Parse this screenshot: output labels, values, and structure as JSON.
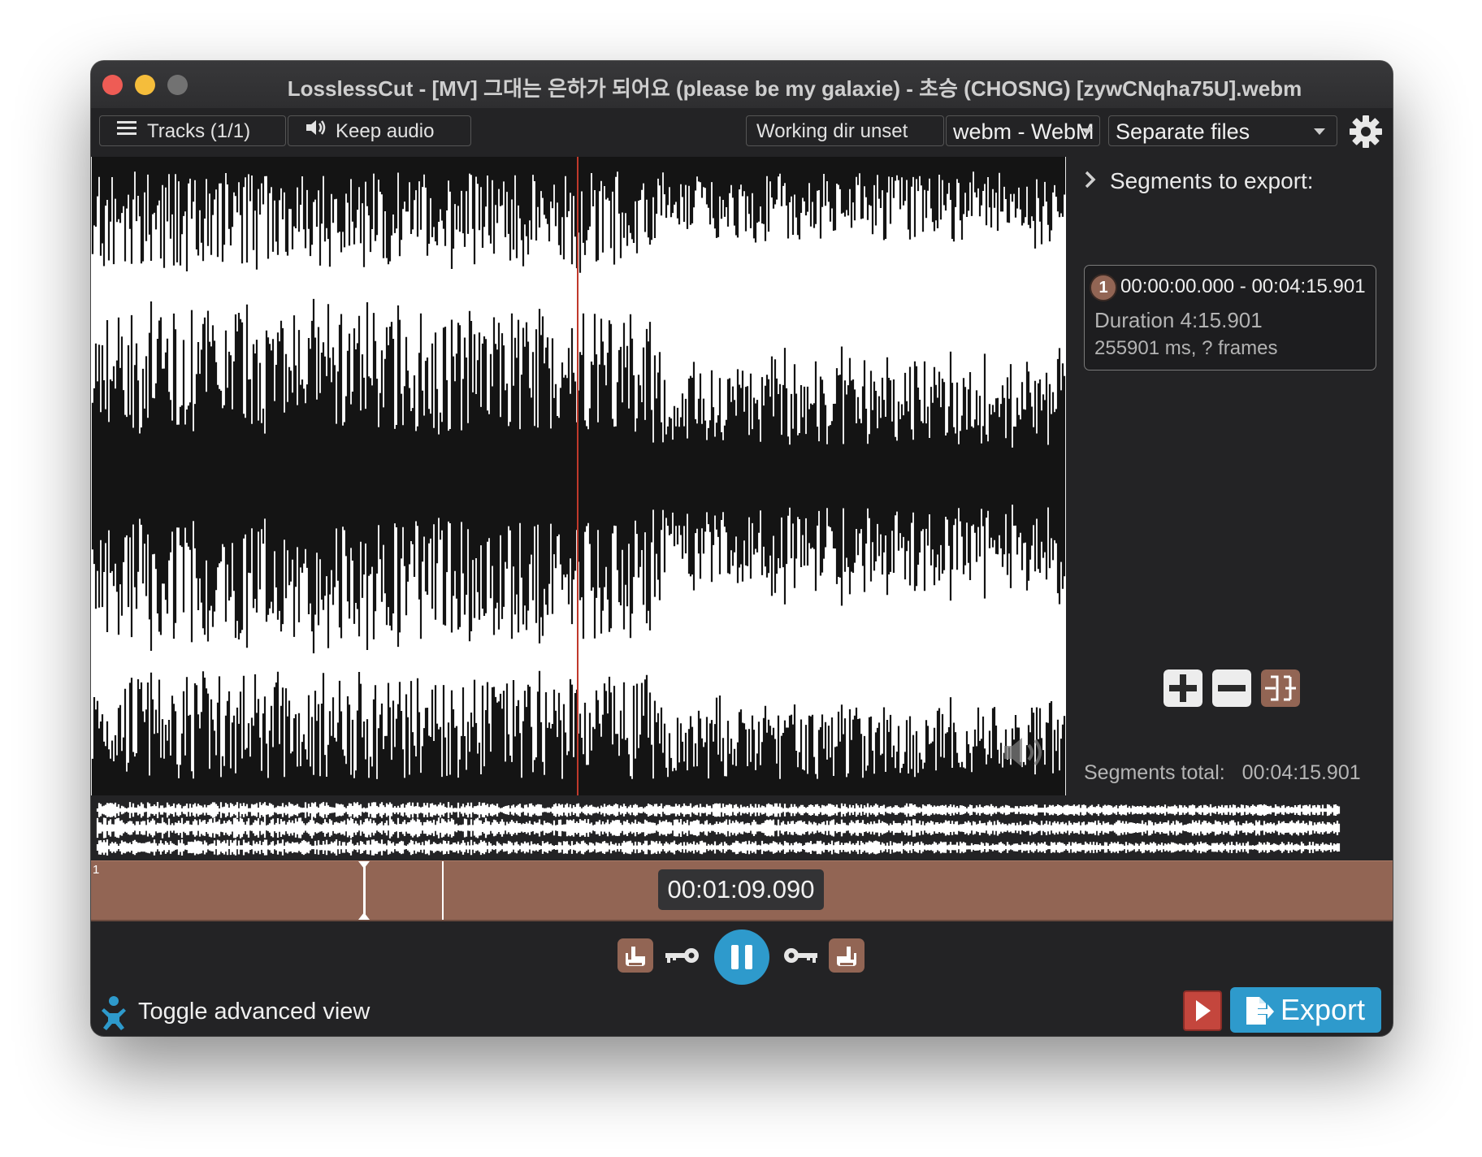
{
  "window": {
    "title": "LosslessCut - [MV] 그대는 은하가 되어요 (please be my galaxie) - 초승 (CHOSNG) [zywCNqha75U].webm"
  },
  "toolbar": {
    "tracks_label": "Tracks (1/1)",
    "keep_audio_label": "Keep audio",
    "working_dir_label": "Working dir unset",
    "format_label": "webm - WebM",
    "output_mode_label": "Separate files"
  },
  "segments": {
    "header": "Segments to export:",
    "items": [
      {
        "index": "1",
        "range": "00:00:00.000 - 00:04:15.901",
        "duration": "Duration 4:15.901",
        "ms_frames": "255901 ms, ? frames"
      }
    ],
    "total_label": "Segments total:",
    "total_value": "00:04:15.901"
  },
  "timeline": {
    "segment_number": "1",
    "current_time": "00:01:09.090"
  },
  "footer": {
    "advanced_label": "Toggle advanced view",
    "export_label": "Export"
  },
  "colors": {
    "accent_blue": "#2e9acc",
    "segment_brown": "#926554",
    "playhead_red": "#c0392b",
    "preview_red": "#c4463d"
  }
}
